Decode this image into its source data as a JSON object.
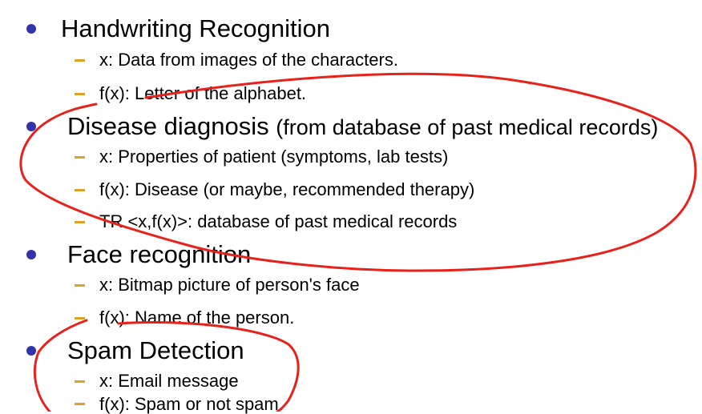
{
  "colors": {
    "bullet": "#3333aa",
    "dash": "#e0a020",
    "text": "#000000",
    "annotation_ink": "#e8221b"
  },
  "sections": [
    {
      "heading": "Handwriting Recognition",
      "items": [
        "x: Data from images of the characters.",
        "f(x): Letter of the alphabet."
      ]
    },
    {
      "heading": "Disease diagnosis",
      "heading_note": "(from database of past medical records)",
      "items": [
        "x: Properties of patient (symptoms, lab tests)",
        "f(x): Disease (or maybe, recommended therapy)",
        "TR <x,f(x)>: database of past medical records"
      ]
    },
    {
      "heading": "Face recognition",
      "items": [
        "x: Bitmap picture of person's face",
        "f(x): Name of the person."
      ]
    },
    {
      "heading": "Spam Detection",
      "items": [
        "x: Email message",
        "f(x): Spam or not spam."
      ]
    }
  ],
  "annotations": [
    "hand-drawn ellipse around Disease diagnosis section",
    "hand-drawn loop around Spam Detection section"
  ]
}
